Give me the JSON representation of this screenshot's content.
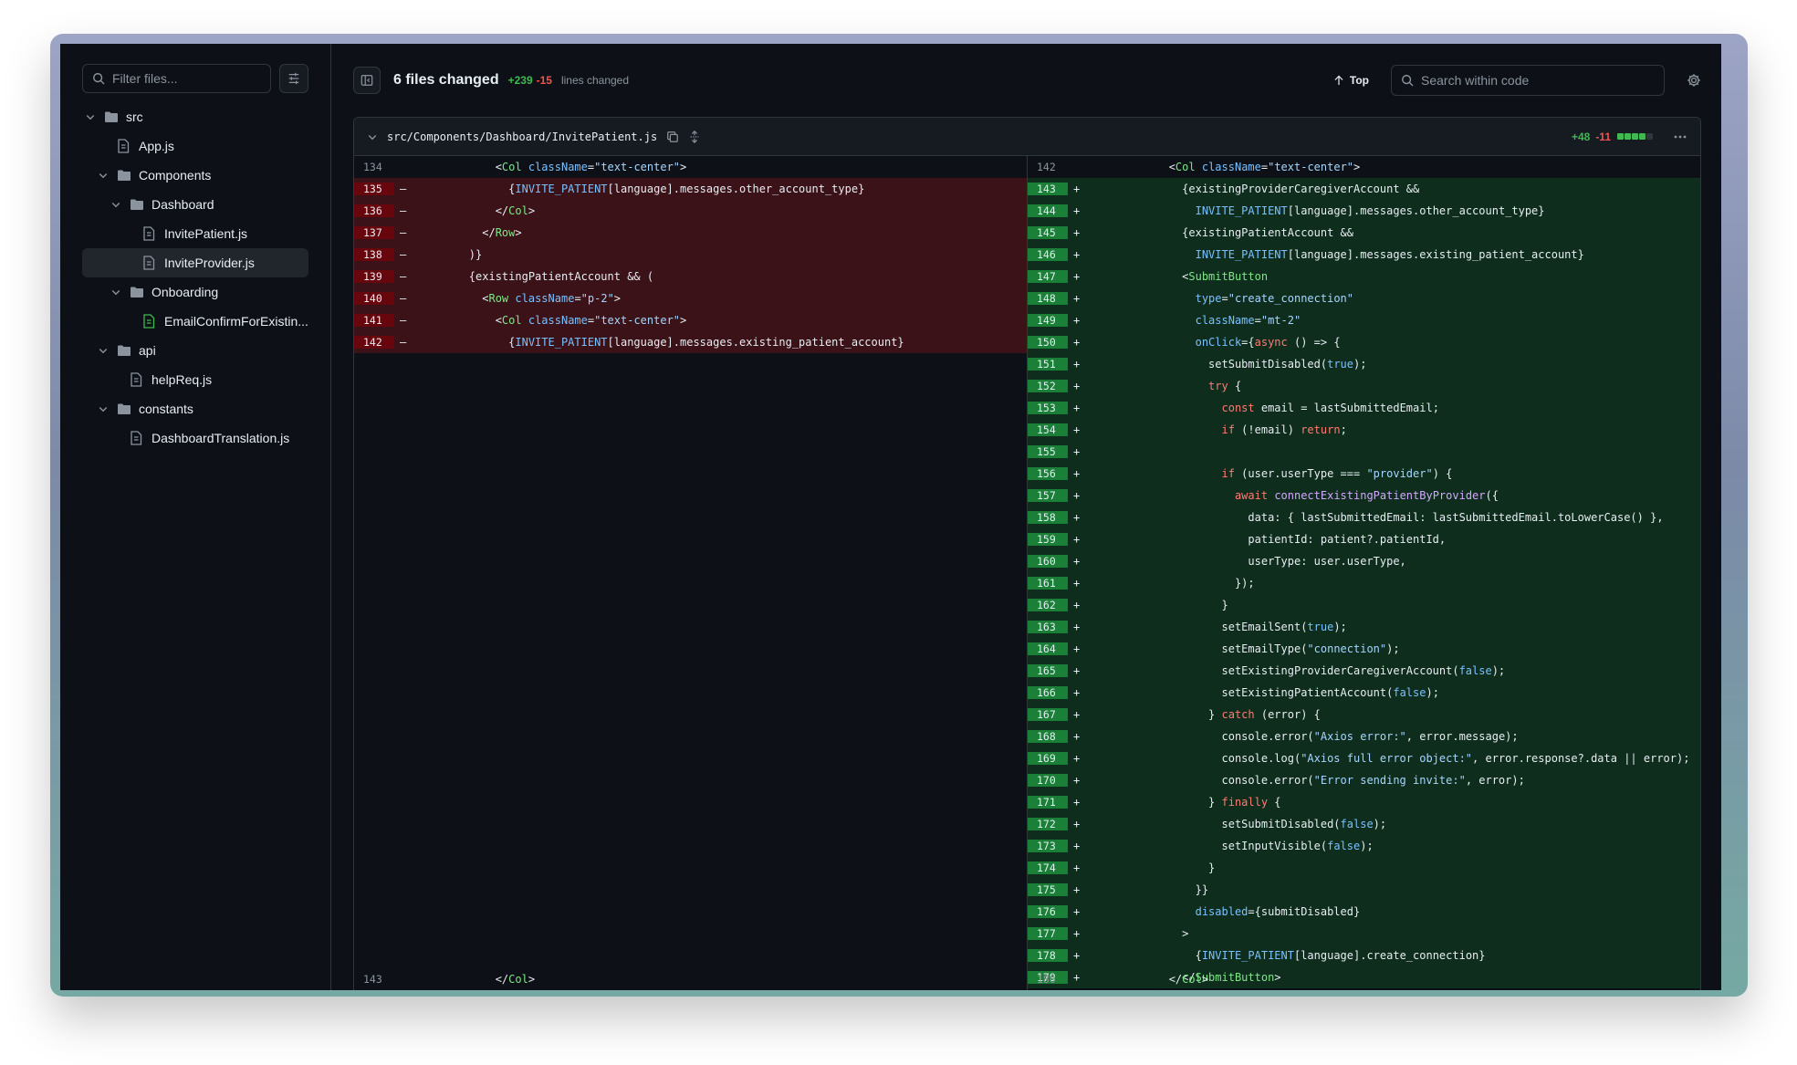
{
  "sidebar": {
    "filter_placeholder": "Filter files...",
    "tree": [
      {
        "label": "src",
        "type": "folder",
        "depth": 0,
        "expanded": true
      },
      {
        "label": "App.js",
        "type": "file",
        "depth": 1
      },
      {
        "label": "Components",
        "type": "folder",
        "depth": 1,
        "expanded": true
      },
      {
        "label": "Dashboard",
        "type": "folder",
        "depth": 2,
        "expanded": true
      },
      {
        "label": "InvitePatient.js",
        "type": "file",
        "depth": 3
      },
      {
        "label": "InviteProvider.js",
        "type": "file",
        "depth": 3,
        "selected": true
      },
      {
        "label": "Onboarding",
        "type": "folder",
        "depth": 2,
        "expanded": true
      },
      {
        "label": "EmailConfirmForExistin...",
        "type": "file-added",
        "depth": 3
      },
      {
        "label": "api",
        "type": "folder",
        "depth": 1,
        "expanded": true
      },
      {
        "label": "helpReq.js",
        "type": "file",
        "depth": 2
      },
      {
        "label": "constants",
        "type": "folder",
        "depth": 1,
        "expanded": true
      },
      {
        "label": "DashboardTranslation.js",
        "type": "file",
        "depth": 2
      }
    ]
  },
  "header": {
    "title": "6 files changed",
    "additions": "+239",
    "deletions": "-15",
    "lines_changed": "lines changed",
    "top_label": "Top",
    "search_placeholder": "Search within code"
  },
  "file": {
    "path": "src/Components/Dashboard/InvitePatient.js",
    "additions": "+48",
    "deletions": "-11",
    "colors": {
      "add": "#3fb950",
      "del": "#f85149",
      "neutral": "#30363d"
    }
  },
  "diff": {
    "left": [
      {
        "n": "134",
        "m": "",
        "t": "ctx",
        "c": "            <Col className=\"text-center\">"
      },
      {
        "n": "135",
        "m": "–",
        "t": "del",
        "c": "              {INVITE_PATIENT[language].messages.other_account_type}"
      },
      {
        "n": "136",
        "m": "–",
        "t": "del",
        "c": "            </Col>"
      },
      {
        "n": "137",
        "m": "–",
        "t": "del",
        "c": "          </Row>"
      },
      {
        "n": "138",
        "m": "–",
        "t": "del",
        "c": "        )}"
      },
      {
        "n": "139",
        "m": "–",
        "t": "del",
        "c": "        {existingPatientAccount && ("
      },
      {
        "n": "140",
        "m": "–",
        "t": "del",
        "c": "          <Row className=\"p-2\">"
      },
      {
        "n": "141",
        "m": "–",
        "t": "del",
        "c": "            <Col className=\"text-center\">"
      },
      {
        "n": "142",
        "m": "–",
        "t": "del",
        "c": "              {INVITE_PATIENT[language].messages.existing_patient_account}"
      }
    ],
    "left_bottom": {
      "n": "143",
      "m": "",
      "t": "ctx",
      "c": "            </Col>"
    },
    "right": [
      {
        "n": "142",
        "m": "",
        "t": "ctx",
        "c": "            <Col className=\"text-center\">"
      },
      {
        "n": "143",
        "m": "+",
        "t": "add",
        "c": "              {existingProviderCaregiverAccount &&"
      },
      {
        "n": "144",
        "m": "+",
        "t": "add",
        "c": "                INVITE_PATIENT[language].messages.other_account_type}"
      },
      {
        "n": "145",
        "m": "+",
        "t": "add",
        "c": "              {existingPatientAccount &&"
      },
      {
        "n": "146",
        "m": "+",
        "t": "add",
        "c": "                INVITE_PATIENT[language].messages.existing_patient_account}"
      },
      {
        "n": "147",
        "m": "+",
        "t": "add",
        "c": "              <SubmitButton"
      },
      {
        "n": "148",
        "m": "+",
        "t": "add",
        "c": "                type=\"create_connection\""
      },
      {
        "n": "149",
        "m": "+",
        "t": "add",
        "c": "                className=\"mt-2\""
      },
      {
        "n": "150",
        "m": "+",
        "t": "add",
        "c": "                onClick={async () => {"
      },
      {
        "n": "151",
        "m": "+",
        "t": "add",
        "c": "                  setSubmitDisabled(true);"
      },
      {
        "n": "152",
        "m": "+",
        "t": "add",
        "c": "                  try {"
      },
      {
        "n": "153",
        "m": "+",
        "t": "add",
        "c": "                    const email = lastSubmittedEmail;"
      },
      {
        "n": "154",
        "m": "+",
        "t": "add",
        "c": "                    if (!email) return;"
      },
      {
        "n": "155",
        "m": "+",
        "t": "add",
        "c": ""
      },
      {
        "n": "156",
        "m": "+",
        "t": "add",
        "c": "                    if (user.userType === \"provider\") {"
      },
      {
        "n": "157",
        "m": "+",
        "t": "add",
        "c": "                      await connectExistingPatientByProvider({"
      },
      {
        "n": "158",
        "m": "+",
        "t": "add",
        "c": "                        data: { lastSubmittedEmail: lastSubmittedEmail.toLowerCase() },"
      },
      {
        "n": "159",
        "m": "+",
        "t": "add",
        "c": "                        patientId: patient?.patientId,"
      },
      {
        "n": "160",
        "m": "+",
        "t": "add",
        "c": "                        userType: user.userType,"
      },
      {
        "n": "161",
        "m": "+",
        "t": "add",
        "c": "                      });"
      },
      {
        "n": "162",
        "m": "+",
        "t": "add",
        "c": "                    }"
      },
      {
        "n": "163",
        "m": "+",
        "t": "add",
        "c": "                    setEmailSent(true);"
      },
      {
        "n": "164",
        "m": "+",
        "t": "add",
        "c": "                    setEmailType(\"connection\");"
      },
      {
        "n": "165",
        "m": "+",
        "t": "add",
        "c": "                    setExistingProviderCaregiverAccount(false);"
      },
      {
        "n": "166",
        "m": "+",
        "t": "add",
        "c": "                    setExistingPatientAccount(false);"
      },
      {
        "n": "167",
        "m": "+",
        "t": "add",
        "c": "                  } catch (error) {"
      },
      {
        "n": "168",
        "m": "+",
        "t": "add",
        "c": "                    console.error(\"Axios error:\", error.message);"
      },
      {
        "n": "169",
        "m": "+",
        "t": "add",
        "c": "                    console.log(\"Axios full error object:\", error.response?.data || error);"
      },
      {
        "n": "170",
        "m": "+",
        "t": "add",
        "c": "                    console.error(\"Error sending invite:\", error);"
      },
      {
        "n": "171",
        "m": "+",
        "t": "add",
        "c": "                  } finally {"
      },
      {
        "n": "172",
        "m": "+",
        "t": "add",
        "c": "                    setSubmitDisabled(false);"
      },
      {
        "n": "173",
        "m": "+",
        "t": "add",
        "c": "                    setInputVisible(false);"
      },
      {
        "n": "174",
        "m": "+",
        "t": "add",
        "c": "                  }"
      },
      {
        "n": "175",
        "m": "+",
        "t": "add",
        "c": "                }}"
      },
      {
        "n": "176",
        "m": "+",
        "t": "add",
        "c": "                disabled={submitDisabled}"
      },
      {
        "n": "177",
        "m": "+",
        "t": "add",
        "c": "              >"
      },
      {
        "n": "178",
        "m": "+",
        "t": "add",
        "c": "                {INVITE_PATIENT[language].create_connection}"
      },
      {
        "n": "179",
        "m": "+",
        "t": "add",
        "c": "              </SubmitButton>"
      }
    ],
    "right_bottom": {
      "n": "180",
      "m": "",
      "t": "ctx",
      "c": "            </Col>"
    }
  }
}
